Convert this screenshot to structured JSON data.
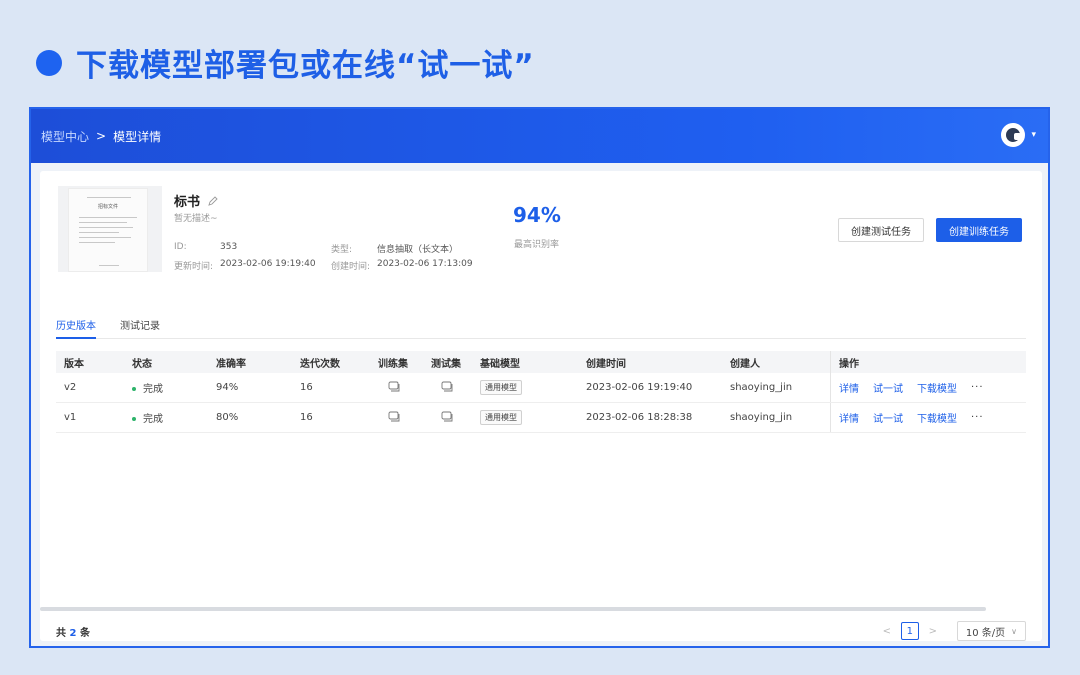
{
  "heading": {
    "text": "下载模型部署包或在线“试一试”",
    "accent": "#1e63f0"
  },
  "topbar": {
    "crumb_parent": "模型中心",
    "crumb_sep": ">",
    "crumb_current": "模型详情",
    "avatar_icon": "user-avatar",
    "caret": "▾"
  },
  "model": {
    "thumb_title": "招标文件",
    "name": "标书",
    "desc": "暂无描述~",
    "id_label": "ID:",
    "id_value": "353",
    "type_label": "类型:",
    "type_value": "信息抽取（长文本）",
    "updated_label": "更新时间:",
    "updated_value": "2023-02-06 19:19:40",
    "created_label": "创建时间:",
    "created_value": "2023-02-06 17:13:09",
    "metric_value": "94%",
    "metric_label": "最高识别率",
    "btn_test": "创建测试任务",
    "btn_train": "创建训练任务"
  },
  "tabs": [
    {
      "label": "历史版本",
      "active": true
    },
    {
      "label": "测试记录",
      "active": false
    }
  ],
  "table": {
    "headers": [
      "版本",
      "状态",
      "准确率",
      "迭代次数",
      "训练集",
      "测试集",
      "基础模型",
      "创建时间",
      "创建人",
      "操作"
    ],
    "rows": [
      {
        "version": "v2",
        "state": "完成",
        "accuracy": "94%",
        "iterations": "16",
        "base": "通用模型",
        "time": "2023-02-06 19:19:40",
        "creator": "shaoying_jin"
      },
      {
        "version": "v1",
        "state": "完成",
        "accuracy": "80%",
        "iterations": "16",
        "base": "通用模型",
        "time": "2023-02-06 18:28:38",
        "creator": "shaoying_jin"
      }
    ],
    "ops": {
      "detail": "详情",
      "try": "试一试",
      "download": "下载模型",
      "more": "···"
    },
    "status_color": "#2db36a"
  },
  "footer": {
    "total_prefix": "共",
    "total_count": "2",
    "total_suffix": "条",
    "prev": "<",
    "page": "1",
    "next": ">",
    "page_size": "10 条/页",
    "page_size_chevron": "∨"
  }
}
